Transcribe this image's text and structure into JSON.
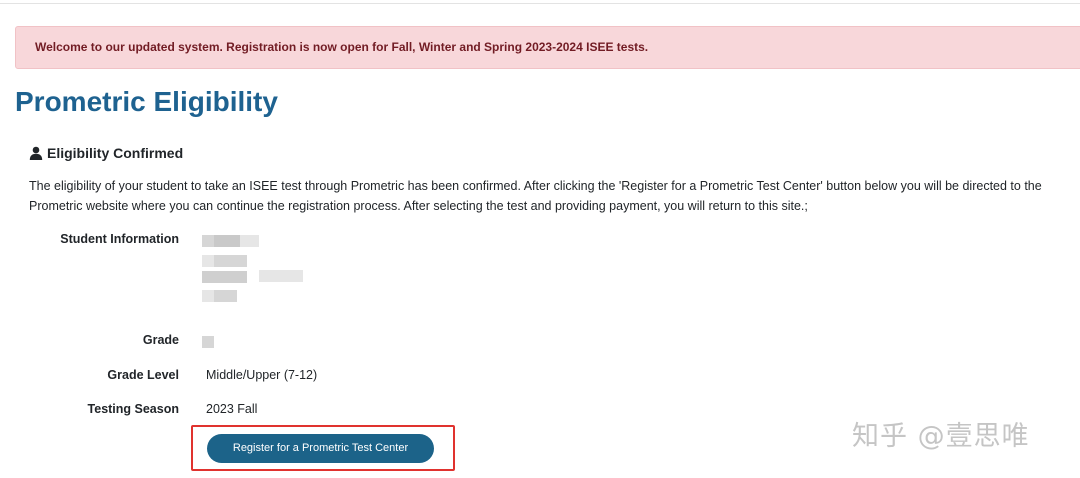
{
  "alert": {
    "message": "Welcome to our updated system. Registration is now open for Fall, Winter and Spring 2023-2024 ISEE tests."
  },
  "page": {
    "title": "Prometric Eligibility"
  },
  "eligibility": {
    "section_title": "Eligibility Confirmed",
    "icon": "user-icon",
    "description": "The eligibility of your student to take an ISEE test through Prometric has been confirmed. After clicking the 'Register for a Prometric Test Center' button below you will be directed to the Prometric website where you can continue the registration process. After selecting the test and providing payment, you will return to this site.;"
  },
  "fields": {
    "student_information_label": "Student Information",
    "grade_label": "Grade",
    "grade_level_label": "Grade Level",
    "grade_level_value": "Middle/Upper (7-12)",
    "testing_season_label": "Testing Season",
    "testing_season_value": "2023 Fall"
  },
  "actions": {
    "register_label": "Register for a Prometric Test Center"
  },
  "watermark": {
    "text": "知乎 @壹思唯"
  },
  "colors": {
    "title": "#1e6290",
    "alert_background": "#f8d7da",
    "alert_text": "#721c24",
    "button": "#1c6389",
    "highlight": "#e0322e"
  }
}
